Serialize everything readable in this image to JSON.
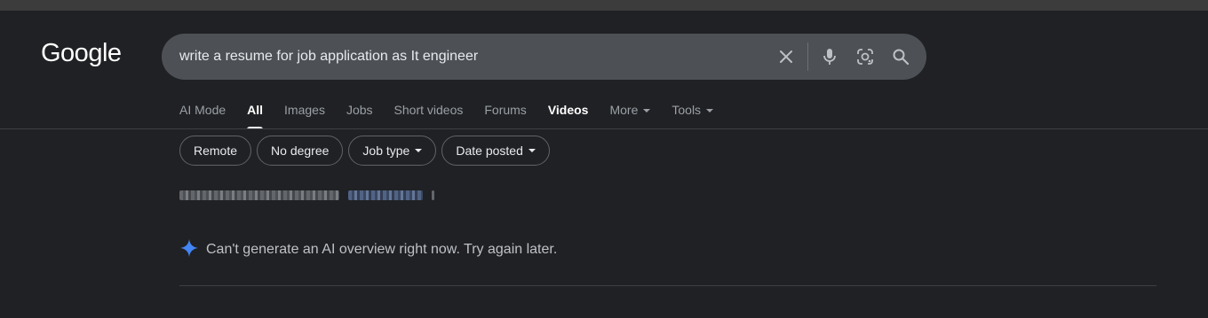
{
  "logo": {
    "text": "Google"
  },
  "search": {
    "value": "write a resume for job application as It engineer",
    "placeholder": "",
    "icons": [
      "close-icon",
      "mic-icon",
      "lens-icon",
      "search-icon"
    ]
  },
  "tabs": [
    {
      "label": "AI Mode"
    },
    {
      "label": "All"
    },
    {
      "label": "Images"
    },
    {
      "label": "Jobs"
    },
    {
      "label": "Short videos"
    },
    {
      "label": "Forums"
    },
    {
      "label": "Videos"
    },
    {
      "label": "More"
    },
    {
      "label": "Tools"
    }
  ],
  "chips": [
    {
      "label": "Remote"
    },
    {
      "label": "No degree"
    },
    {
      "label": "Job type"
    },
    {
      "label": "Date posted"
    }
  ],
  "ai_overview": {
    "message": "Can't generate an AI overview right now. Try again later.",
    "icon": "sparkle-icon",
    "icon_color": "#4285f4"
  },
  "colors": {
    "background": "#202124",
    "searchbox": "#4d5156",
    "text": "#e8eaed",
    "muted": "#9aa0a6"
  }
}
